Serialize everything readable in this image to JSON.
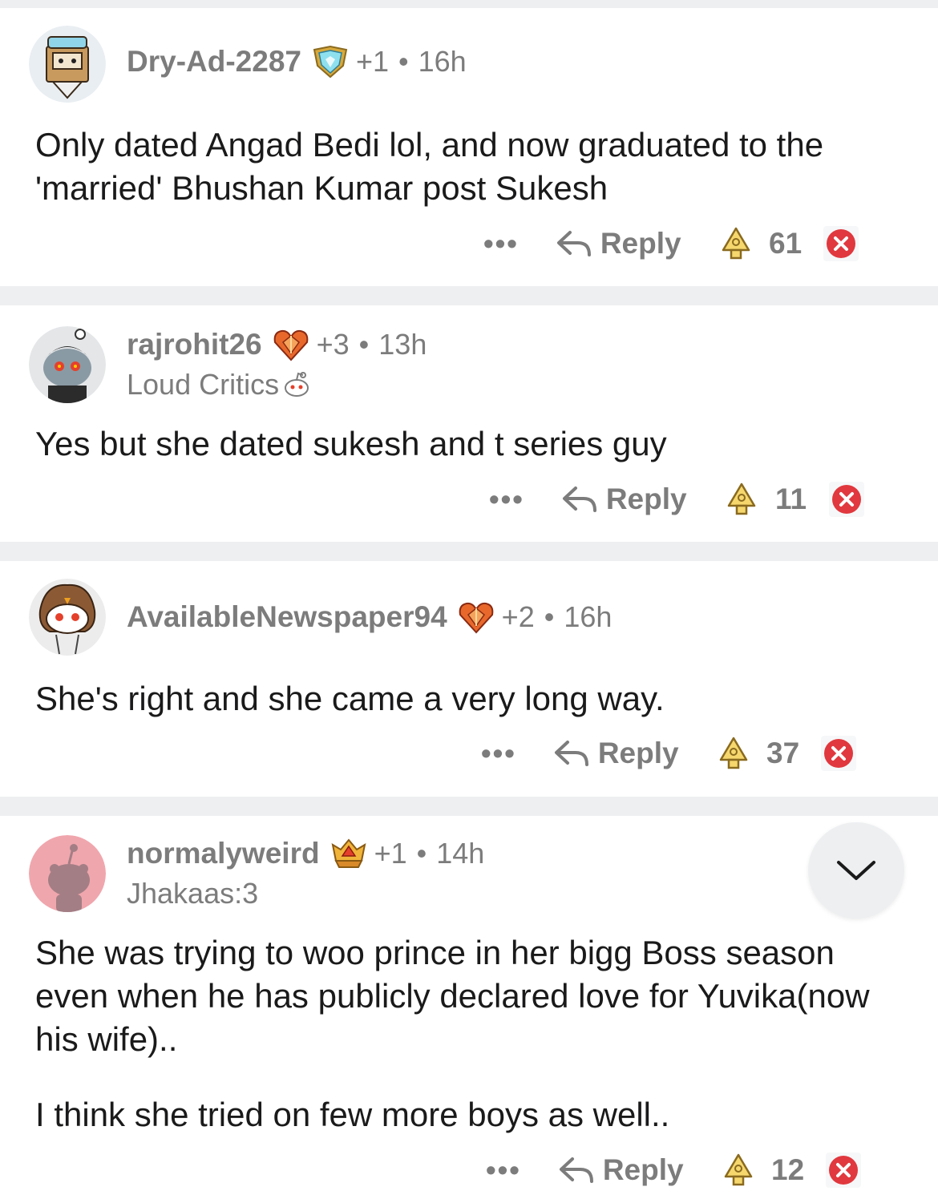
{
  "actions": {
    "more_label": "•••",
    "reply_label": "Reply"
  },
  "comments": [
    {
      "username": "Dry-Ad-2287",
      "karma": "+1",
      "separator": "•",
      "time": "16h",
      "flair": "",
      "award_icon": "shield-award-icon",
      "body": [
        "Only dated Angad Bedi lol, and now graduated to the 'married' Bhushan Kumar post Sukesh"
      ],
      "score": "61"
    },
    {
      "username": "rajrohit26",
      "karma": "+3",
      "separator": "•",
      "time": "13h",
      "flair": "Loud Critics",
      "award_icon": "crystal-heart-award-icon",
      "body": [
        "Yes but she dated sukesh and t series guy"
      ],
      "score": "11"
    },
    {
      "username": "AvailableNewspaper94",
      "karma": "+2",
      "separator": "•",
      "time": "16h",
      "flair": "",
      "award_icon": "crystal-heart-award-icon",
      "body": [
        "She's right and she came a very long way."
      ],
      "score": "37"
    },
    {
      "username": "normalyweird",
      "karma": "+1",
      "separator": "•",
      "time": "14h",
      "flair": "Jhakaas:3",
      "award_icon": "crown-shield-award-icon",
      "body": [
        "She was trying to woo prince in her bigg Boss season even when he has publicly declared love for Yuvika(now his wife)..",
        "I think she tried on few more boys as well.."
      ],
      "score": "12"
    }
  ],
  "colors": {
    "text": "#1a1a1b",
    "meta": "#7c7c7c",
    "divider": "#edeff1",
    "downvote": "#e0383e",
    "upvote": "#e8c13a"
  }
}
